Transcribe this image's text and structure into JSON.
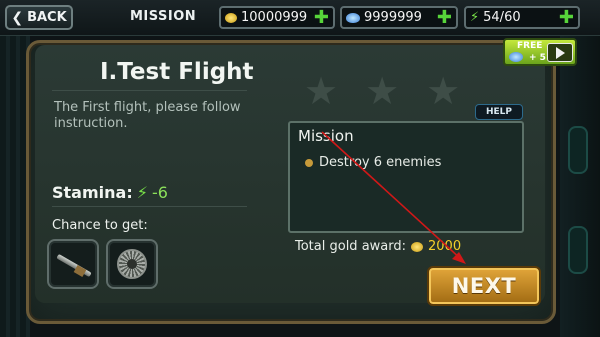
{
  "topbar": {
    "back_label": "BACK",
    "title": "MISSION",
    "gold": "10000999",
    "gems": "9999999",
    "stamina": "54/60"
  },
  "level": {
    "title": "I.Test Flight",
    "description": "The First flight, please follow instruction.",
    "stars_earned": 0,
    "stars_total": 3
  },
  "help_label": "HELP",
  "free_video": {
    "free_label": "FREE",
    "bonus_label": "+ 5"
  },
  "mission": {
    "heading": "Mission",
    "items": [
      "Destroy 6 enemies"
    ]
  },
  "stamina": {
    "label": "Stamina:",
    "cost": "-6"
  },
  "rewards": {
    "label": "Chance to get:",
    "items": [
      "rifle-icon",
      "gear-icon"
    ]
  },
  "gold_award": {
    "label": "Total gold award:",
    "amount": "2000"
  },
  "next_label": "NEXT",
  "colors": {
    "accent_gold": "#f4d02a",
    "stamina_green": "#78e048",
    "panel_bg": "#202d29",
    "button_orange": "#d2962a",
    "arrow_red": "#d01818"
  }
}
